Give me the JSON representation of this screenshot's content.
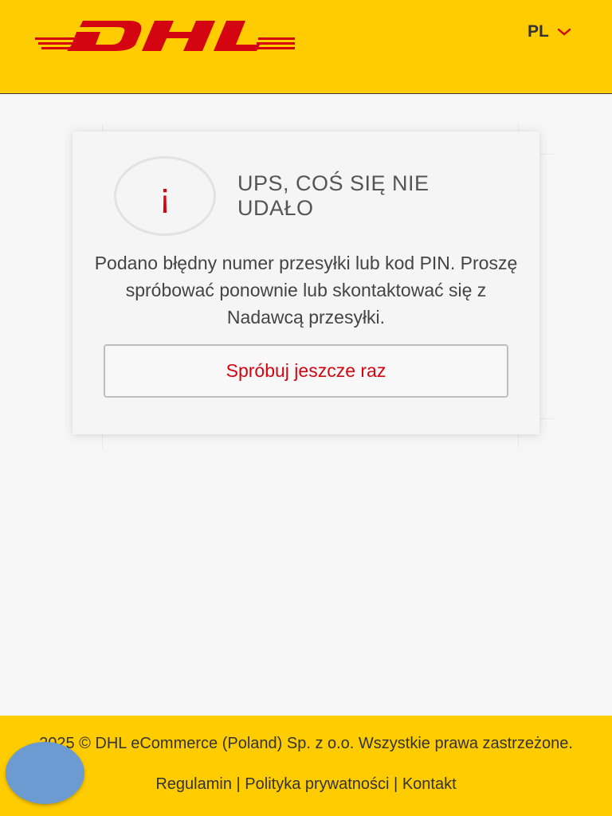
{
  "header": {
    "logo_text": "DHL",
    "language": "PL",
    "icons": {
      "language_dropdown": "chevron-down-icon"
    },
    "colors": {
      "brand_yellow": "#ffcc00",
      "brand_red": "#d40511"
    }
  },
  "error_card": {
    "icon": "info-icon",
    "icon_glyph": "¡",
    "title": "UPS, COŚ SIĘ NIE UDAŁO",
    "message": "Podano błędny numer przesyłki lub kod PIN. Proszę spróbować ponownie lub skontaktować się z Nadawcą przesyłki.",
    "retry_label": "Spróbuj jeszcze raz"
  },
  "footer": {
    "copyright": "2025 © DHL eCommerce (Poland) Sp. z o.o.  Wszystkie prawa zastrzeżone.",
    "links": {
      "terms": "Regulamin",
      "privacy": "Polityka prywatności",
      "contact": "Kontakt",
      "separator": "|"
    }
  }
}
